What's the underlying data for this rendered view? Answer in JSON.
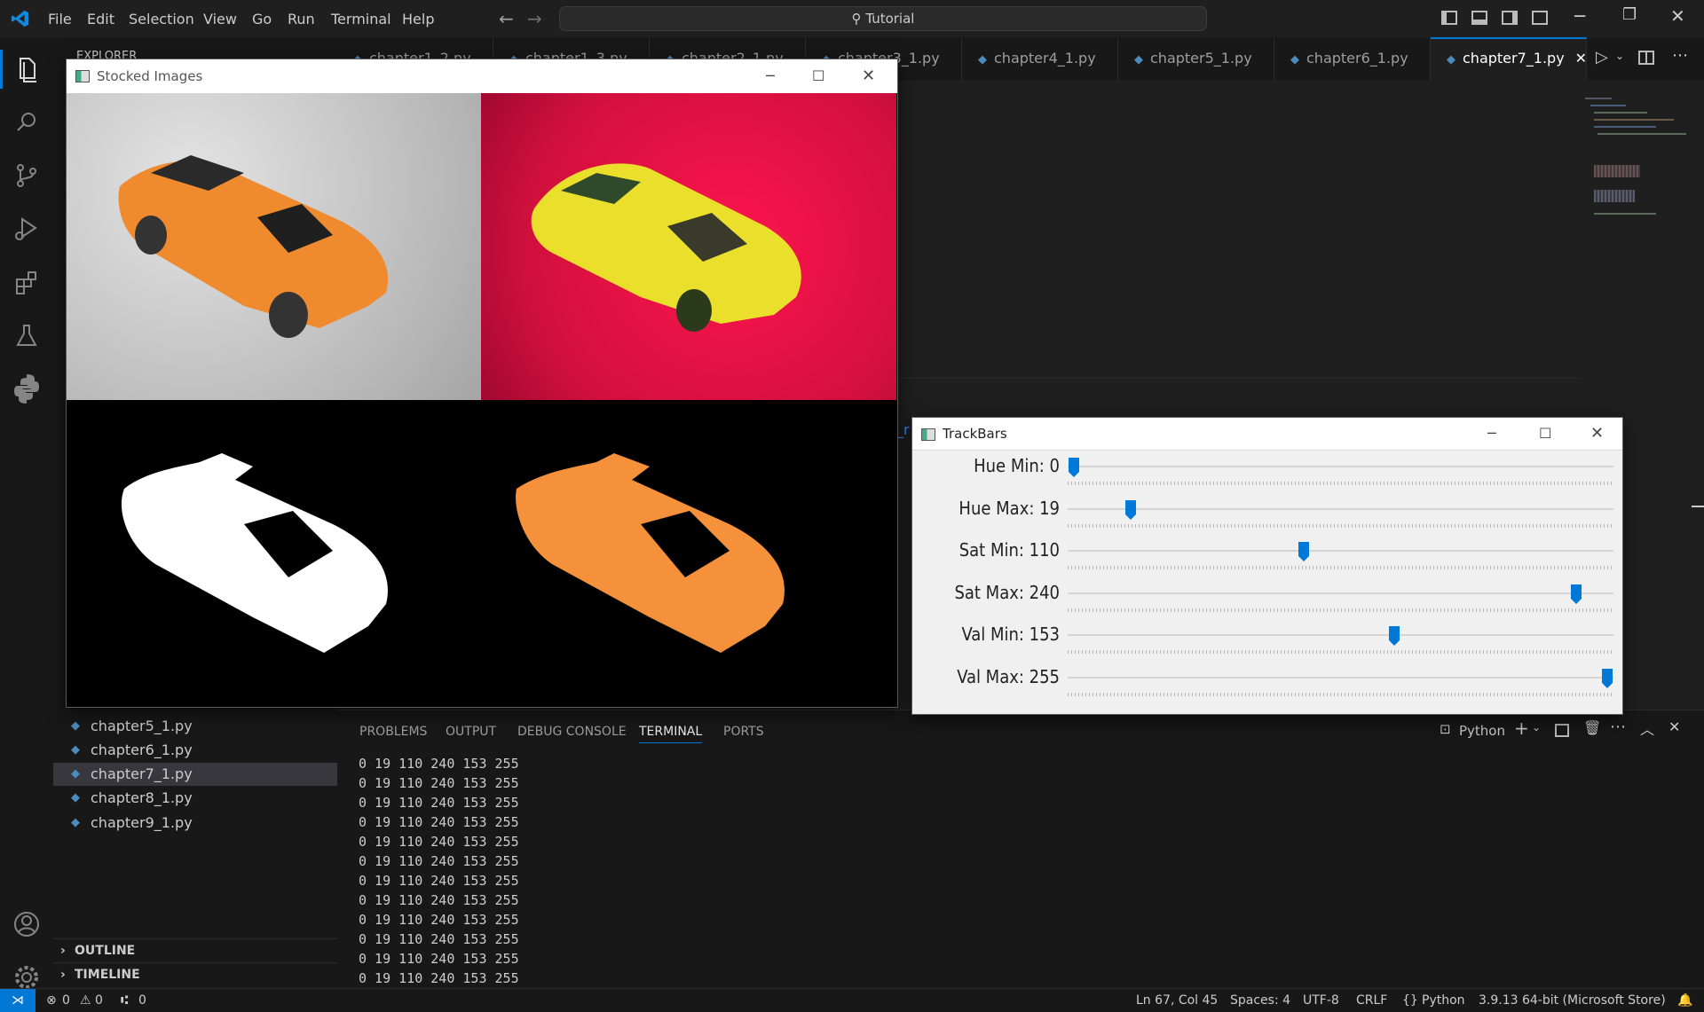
{
  "titlebar": {
    "menu": [
      "File",
      "Edit",
      "Selection",
      "View",
      "Go",
      "Run",
      "Terminal",
      "Help"
    ],
    "search": "Tutorial"
  },
  "sidebar": {
    "header": "EXPLORER",
    "files": [
      "chapter5_1.py",
      "chapter6_1.py",
      "chapter7_1.py",
      "chapter8_1.py",
      "chapter9_1.py"
    ],
    "active_file": "chapter7_1.py",
    "sections": [
      "OUTLINE",
      "TIMELINE"
    ]
  },
  "tabs": [
    "chapter1_2.py",
    "chapter1_3.py",
    "chapter2_1.py",
    "chapter3_1.py",
    "chapter4_1.py",
    "chapter5_1.py",
    "chapter6_1.py",
    "chapter7_1.py"
  ],
  "active_tab": "chapter7_1.py",
  "panel": {
    "tabs": [
      "PROBLEMS",
      "OUTPUT",
      "DEBUG CONSOLE",
      "TERMINAL",
      "PORTS"
    ],
    "active_tab": "TERMINAL",
    "terminal_name": "Python",
    "lines": [
      "0 19 110 240 153 255",
      "0 19 110 240 153 255",
      "0 19 110 240 153 255",
      "0 19 110 240 153 255",
      "0 19 110 240 153 255",
      "0 19 110 240 153 255",
      "0 19 110 240 153 255",
      "0 19 110 240 153 255",
      "0 19 110 240 153 255",
      "0 19 110 240 153 255",
      "0 19 110 240 153 255",
      "0 19 110 240 153 255"
    ]
  },
  "stacked_window": {
    "title": "Stocked Images"
  },
  "trackbars_window": {
    "title": "TrackBars",
    "bars": [
      {
        "label": "Hue Min: 0",
        "value": 0,
        "max": 179
      },
      {
        "label": "Hue Max: 19",
        "value": 19,
        "max": 179
      },
      {
        "label": "Sat Min: 110",
        "value": 110,
        "max": 255
      },
      {
        "label": "Sat Max: 240",
        "value": 240,
        "max": 255
      },
      {
        "label": "Val Min: 153",
        "value": 153,
        "max": 255
      },
      {
        "label": "Val Max: 255",
        "value": 255,
        "max": 255
      }
    ]
  },
  "statusbar": {
    "errors": "0",
    "warnings": "0",
    "ports": "0",
    "position": "Ln 67, Col 45",
    "spaces": "Spaces: 4",
    "encoding": "UTF-8",
    "eol": "CRLF",
    "language": "Python",
    "interpreter": "3.9.13 64-bit (Microsoft Store)"
  },
  "colors": {
    "accent": "#0078d4",
    "thumb": "#0078d7"
  }
}
